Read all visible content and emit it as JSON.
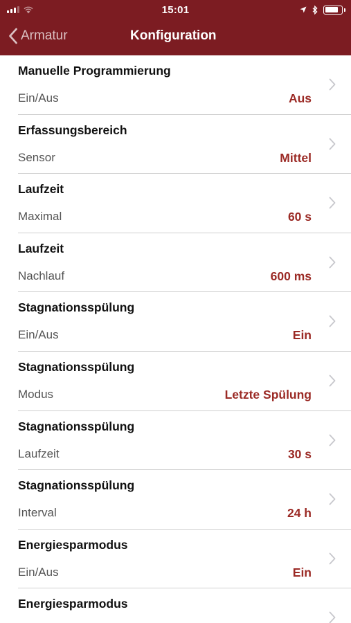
{
  "status_bar": {
    "time": "15:01",
    "icons": [
      "signal-icon",
      "wifi-icon",
      "location-icon",
      "bluetooth-icon",
      "battery-icon"
    ]
  },
  "nav": {
    "back_label": "Armatur",
    "title": "Konfiguration"
  },
  "colors": {
    "bar": "#7c1c22",
    "value": "#9b2a25",
    "chevron": "#c7c7cc"
  },
  "settings": [
    {
      "title": "Manuelle Programmierung",
      "label": "Ein/Aus",
      "value": "Aus"
    },
    {
      "title": "Erfassungsbereich",
      "label": "Sensor",
      "value": "Mittel"
    },
    {
      "title": "Laufzeit",
      "label": "Maximal",
      "value": "60 s"
    },
    {
      "title": "Laufzeit",
      "label": "Nachlauf",
      "value": "600 ms"
    },
    {
      "title": "Stagnationsspülung",
      "label": "Ein/Aus",
      "value": "Ein"
    },
    {
      "title": "Stagnationsspülung",
      "label": "Modus",
      "value": "Letzte Spülung"
    },
    {
      "title": "Stagnationsspülung",
      "label": "Laufzeit",
      "value": "30 s"
    },
    {
      "title": "Stagnationsspülung",
      "label": "Interval",
      "value": "24 h"
    },
    {
      "title": "Energiesparmodus",
      "label": "Ein/Aus",
      "value": "Ein"
    },
    {
      "title": "Energiesparmodus",
      "label": "",
      "value": ""
    }
  ]
}
